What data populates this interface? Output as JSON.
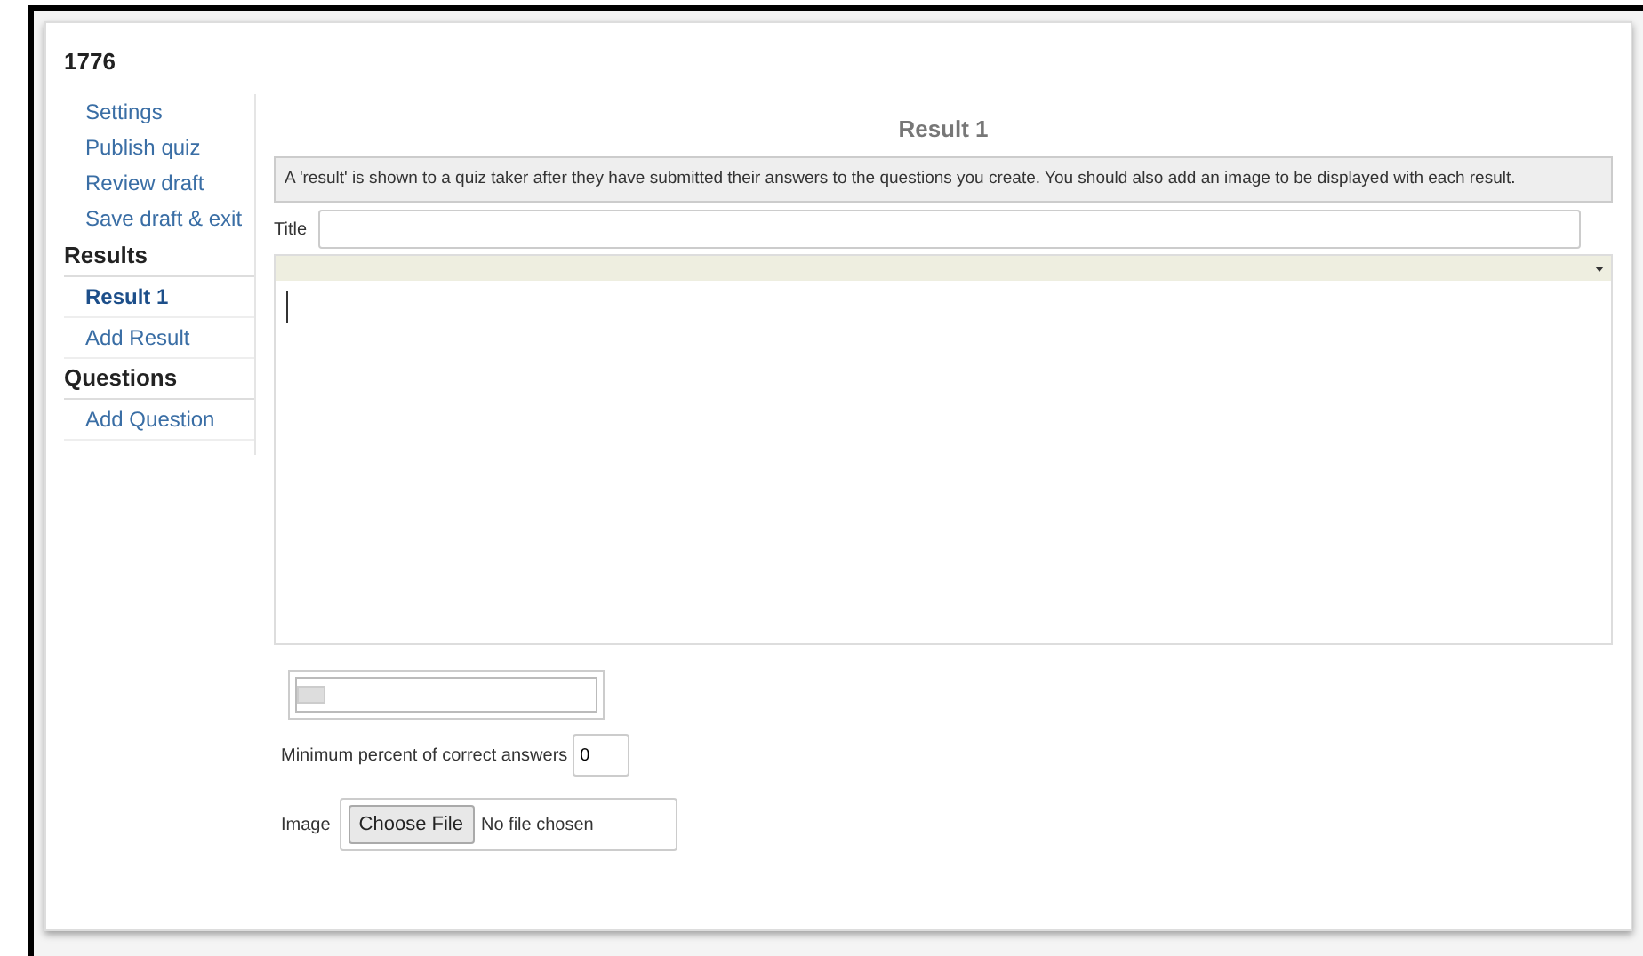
{
  "quiz_title": "1776",
  "sidebar": {
    "links": [
      {
        "label": "Settings"
      },
      {
        "label": "Publish quiz"
      },
      {
        "label": "Review draft"
      },
      {
        "label": "Save draft & exit"
      }
    ],
    "sections": [
      {
        "heading": "Results",
        "items": [
          {
            "label": "Result 1",
            "selected": true
          },
          {
            "label": "Add Result",
            "selected": false
          }
        ]
      },
      {
        "heading": "Questions",
        "items": [
          {
            "label": "Add Question",
            "selected": false
          }
        ]
      }
    ]
  },
  "heading": "Result 1",
  "info": "A 'result' is shown to a quiz taker after they have submitted their answers to the questions you create. You should also add an image to be displayed with each result.",
  "title_field": {
    "label": "Title"
  },
  "slider": {
    "level": 0
  },
  "min_percent": {
    "label": "Minimum percent of correct answers",
    "value": "0"
  },
  "image": {
    "label": "Image",
    "button": "Choose File",
    "status": "No file chosen"
  }
}
